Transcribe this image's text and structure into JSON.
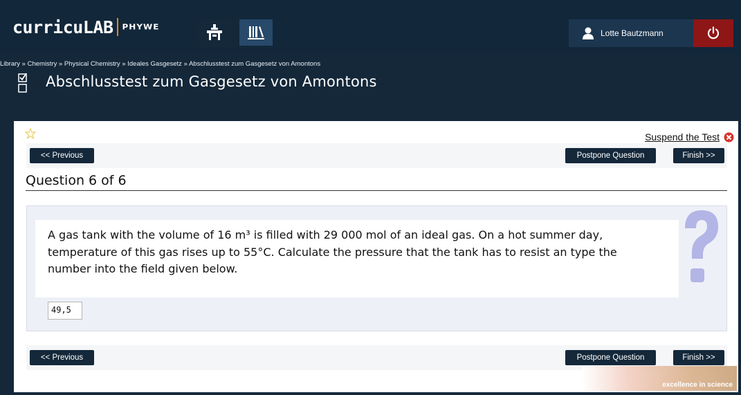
{
  "app": {
    "logo_main": "curricuLAB",
    "logo_brand": "PHYWE",
    "nav_icons": [
      "desk-icon",
      "library-icon"
    ],
    "user_name": "Lotte Bautzmann",
    "user_icon": "user-icon",
    "power_icon": "power-icon"
  },
  "header": {
    "breadcrumb": "Library » Chemistry » Physical Chemistry » Ideales Gasgesetz » Abschlusstest zum Gasgesetz von Amontons",
    "title": "Abschlusstest zum Gasgesetz von Amontons",
    "title_icon": "checklist-icon"
  },
  "toolbar": {
    "suspend_label": "Suspend the Test",
    "previous_label": "<< Previous",
    "postpone_label": "Postpone Question",
    "finish_label": "Finish >>"
  },
  "question": {
    "heading": "Question 6 of 6",
    "text": "A gas tank with the volume of  16 m³ is filled with 29 000 mol of an ideal gas. On a hot summer day, temperature of this gas rises up to 55°C. Calculate the pressure that the tank has to resist an type the number into the field given below.",
    "answer_value": "49,5"
  },
  "footer": {
    "brand_tagline": "excellence in science"
  },
  "colors": {
    "dark_navy": "#14283a",
    "power_red": "#8e1616",
    "accent_orange": "#e8831f",
    "panel_bg": "#eef0f8"
  }
}
